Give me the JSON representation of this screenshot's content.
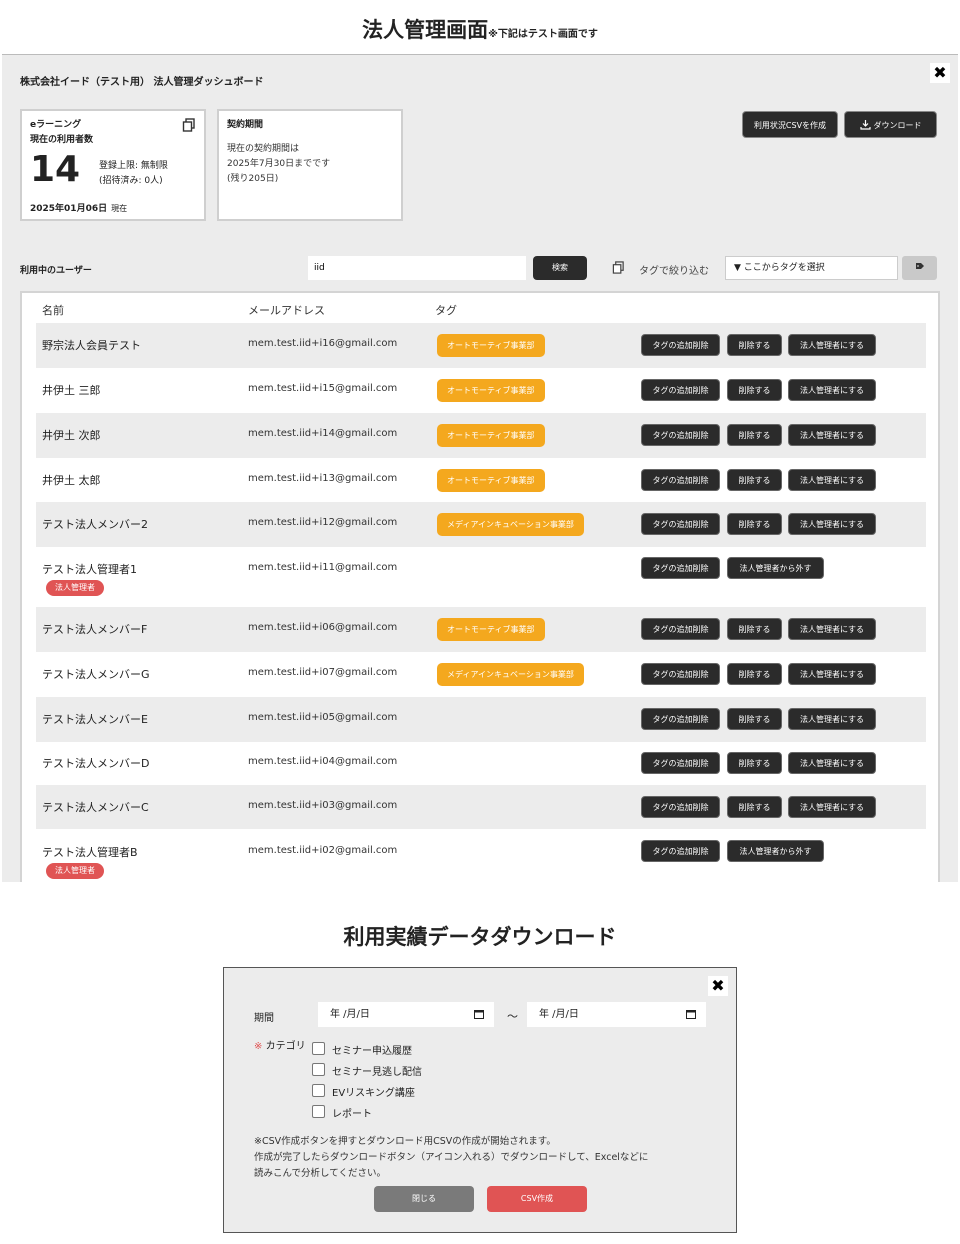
{
  "header": {
    "title": "法人管理画面",
    "note": "※下記はテスト画面です"
  },
  "dashboard": {
    "title": "株式会社イード（テスト用） 法人管理ダッシュボード",
    "close_glyph": "✖",
    "card_users": {
      "line1": "eラーニング",
      "line2": "現在の利用者数",
      "count": "14",
      "limit": "登録上限: 無制限",
      "invited": "(招待済み: 0人)",
      "date": "2025年01月06日",
      "date_suffix": "現在"
    },
    "card_contract": {
      "title": "契約期間",
      "line1": "現在の契約期間は",
      "line2": "2025年7月30日までです",
      "line3": "(残り205日)"
    },
    "csv_button": "利用状況CSVを作成",
    "download_button": "ダウンロード",
    "users_label": "利用中のユーザー",
    "search_value": "iid",
    "search_button": "検索",
    "tag_filter_label": "タグで絞り込む",
    "tag_select": "▼ ここからタグを選択",
    "tag_apply_icon": "tag-icon",
    "table": {
      "headers": {
        "name": "名前",
        "email": "メールアドレス",
        "tag": "タグ"
      },
      "buttons": {
        "tag_edit": "タグの追加削除",
        "delete": "削除する",
        "make_admin": "法人管理者にする",
        "remove_admin": "法人管理者から外す"
      },
      "admin_badge": "法人管理者",
      "rows": [
        {
          "name": "野宗法人会員テスト",
          "email": "mem.test.iid+i16@gmail.com",
          "tag": "オートモーティブ事業部"
        },
        {
          "name": "井伊土 三郎",
          "email": "mem.test.iid+i15@gmail.com",
          "tag": "オートモーティブ事業部"
        },
        {
          "name": "井伊土 次郎",
          "email": "mem.test.iid+i14@gmail.com",
          "tag": "オートモーティブ事業部"
        },
        {
          "name": "井伊土 太郎",
          "email": "mem.test.iid+i13@gmail.com",
          "tag": "オートモーティブ事業部"
        },
        {
          "name": "テスト法人メンバー2",
          "email": "mem.test.iid+i12@gmail.com",
          "tag": "メディアインキュベーション事業部"
        },
        {
          "name": "テスト法人管理者1",
          "email": "mem.test.iid+i11@gmail.com",
          "tag": ""
        },
        {
          "name": "テスト法人メンバーF",
          "email": "mem.test.iid+i06@gmail.com",
          "tag": "オートモーティブ事業部"
        },
        {
          "name": "テスト法人メンバーG",
          "email": "mem.test.iid+i07@gmail.com",
          "tag": "メディアインキュベーション事業部"
        },
        {
          "name": "テスト法人メンバーE",
          "email": "mem.test.iid+i05@gmail.com",
          "tag": ""
        },
        {
          "name": "テスト法人メンバーD",
          "email": "mem.test.iid+i04@gmail.com",
          "tag": ""
        },
        {
          "name": "テスト法人メンバーC",
          "email": "mem.test.iid+i03@gmail.com",
          "tag": ""
        },
        {
          "name": "テスト法人管理者B",
          "email": "mem.test.iid+i02@gmail.com",
          "tag": ""
        }
      ]
    }
  },
  "download_section": {
    "title": "利用実績データダウンロード",
    "close_glyph": "✖",
    "period_label": "期間",
    "date_placeholder": "年 /月/日",
    "tilde": "〜",
    "category_required_mark": "※",
    "category_label": "カテゴリ",
    "categories": [
      "セミナー申込履歴",
      "セミナー見逃し配信",
      "EVリスキング講座",
      "レポート"
    ],
    "note_lines": [
      "※CSV作成ボタンを押すとダウンロード用CSVの作成が開始されます。",
      "作成が完了したらダウンロードボタン（アイコン入れる）でダウンロードして、Excelなどに",
      "読みこんで分析してください。"
    ],
    "close_button": "閉じる",
    "csv_button": "CSV作成"
  },
  "colors": {
    "tag_orange": "#f4a81e",
    "admin_red": "#e05454",
    "dark_button": "#2b2b2b"
  }
}
